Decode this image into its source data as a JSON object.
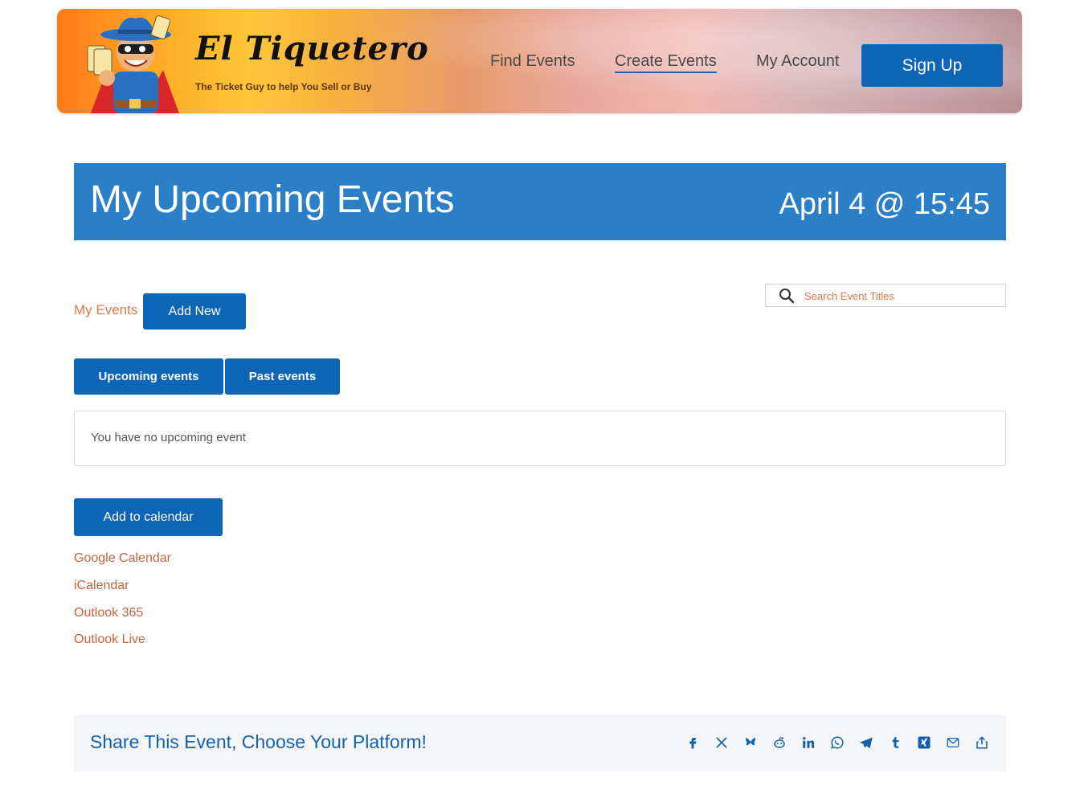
{
  "header": {
    "brand_title": "El Tiquetero",
    "brand_tagline": "The Ticket Guy to help You Sell or Buy",
    "nav": {
      "find_events": "Find Events",
      "create_events": "Create Events",
      "my_account": "My Account",
      "sign_up": "Sign Up"
    },
    "gradient_colors": [
      "#ff7a1a",
      "#ffc63a",
      "#e9a9a0",
      "#b89096"
    ]
  },
  "banner": {
    "title": "My Upcoming Events",
    "date": "April 4 @ 15:45",
    "color": "#2a7fc6"
  },
  "my_events": {
    "label": "My Events",
    "add_new": "Add New"
  },
  "search": {
    "placeholder": "Search Event Titles",
    "icon": "search-icon"
  },
  "tabs": {
    "upcoming": "Upcoming events",
    "past": "Past events"
  },
  "empty_message": "You have no upcoming event",
  "calendar": {
    "button": "Add to calendar",
    "links": [
      "Google Calendar",
      "iCalendar",
      "Outlook 365",
      "Outlook Live"
    ]
  },
  "share": {
    "title": "Share This Event, Choose Your Platform!",
    "icons": [
      "facebook-icon",
      "x-icon",
      "bluesky-icon",
      "reddit-icon",
      "linkedin-icon",
      "whatsapp-icon",
      "telegram-icon",
      "tumblr-icon",
      "xing-icon",
      "email-icon",
      "share-icon"
    ]
  },
  "colors": {
    "primary_button": "#0d65b8",
    "link_orange": "#c8643a",
    "share_blue": "#1460ad"
  }
}
